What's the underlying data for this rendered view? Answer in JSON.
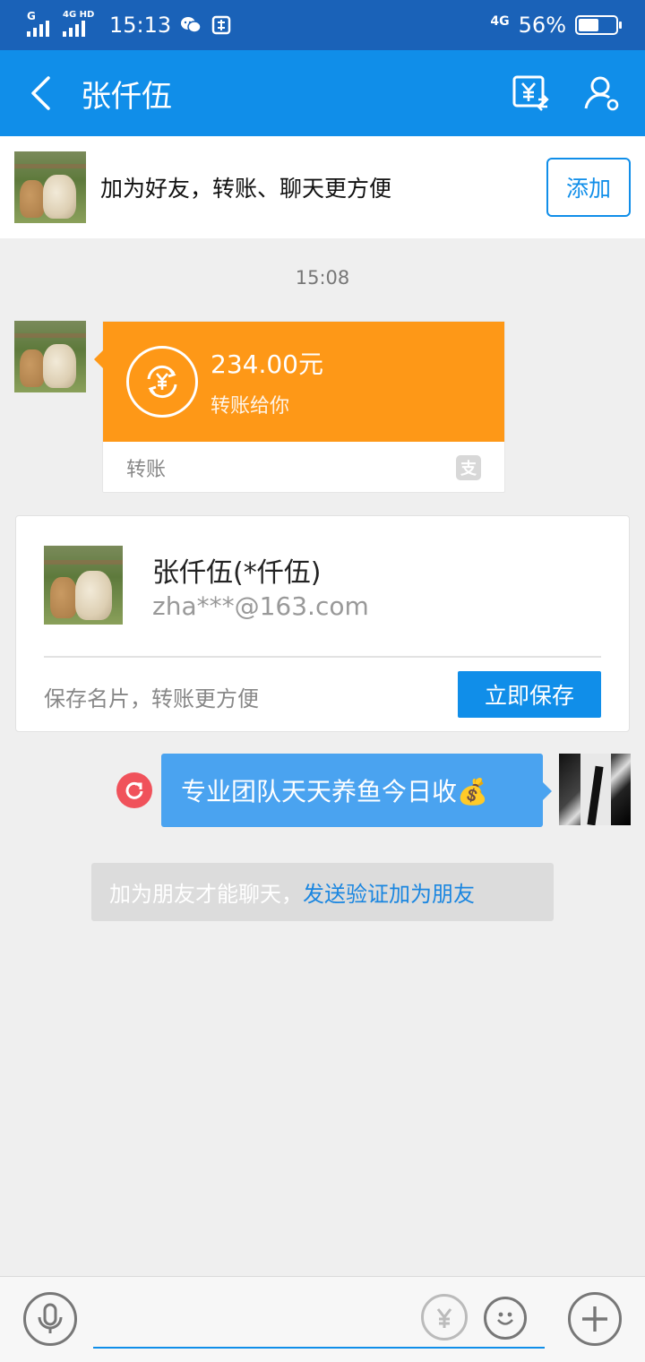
{
  "status_bar": {
    "signal1": "G",
    "signal2": "4G HD",
    "time": "15:13",
    "network": "4G",
    "battery": "56%",
    "battery_level": 0.56
  },
  "header": {
    "title": "张仟伍",
    "back_icon": "back-arrow-icon",
    "transfer_icon": "yuan-transfer-icon",
    "profile_icon": "user-settings-icon"
  },
  "add_friend_bar": {
    "text": "加为好友，转账、聊天更方便",
    "button": "添加"
  },
  "chat": {
    "timestamp": "15:08",
    "transfer": {
      "amount": "234.00元",
      "subtitle": "转账给你",
      "label": "转账",
      "brand_icon": "alipay-icon",
      "brand_glyph": "支"
    },
    "contact_card": {
      "name": "张仟伍(*仟伍)",
      "email": "zha***@163.com",
      "hint": "保存名片，转账更方便",
      "button": "立即保存"
    },
    "outgoing": {
      "text": "专业团队天天养鱼今日收💰",
      "status_icon": "resend-icon"
    },
    "notice": {
      "text": "加为朋友才能聊天，",
      "link": "发送验证加为朋友"
    }
  },
  "input_bar": {
    "voice_icon": "microphone-icon",
    "transfer_icon": "yuan-transfer-icon",
    "emoji_icon": "emoji-icon",
    "more_icon": "plus-icon"
  },
  "colors": {
    "status_bar": "#1a62b8",
    "header": "#108ee9",
    "transfer_orange": "#fe9817",
    "bubble_blue": "#4aa3f0",
    "resend_red": "#f0525b"
  }
}
